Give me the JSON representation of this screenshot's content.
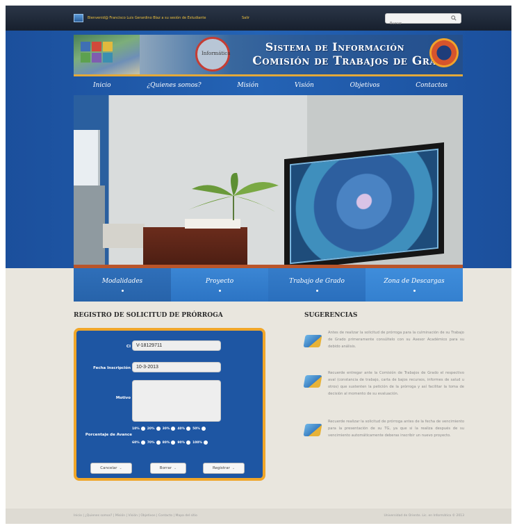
{
  "topbar": {
    "welcome": "Bienvenid@ Francisco Luis Gerardino Blaz a su sesión de Estudiante",
    "logout": "Salir",
    "search_placeholder": "Buscar"
  },
  "banner": {
    "title_line1": "Sistema de Información",
    "title_line2": "Comisión de Trabajos de Grado",
    "seal_text": "Informática"
  },
  "main_nav": [
    "Inicio",
    "¿Quienes somos?",
    "Misión",
    "Visión",
    "Objetivos",
    "Contactos"
  ],
  "sub_nav": [
    "Modalidades",
    "Proyecto",
    "Trabajo de Grado",
    "Zona de Descargas"
  ],
  "form": {
    "heading": "REGISTRO DE SOLICITUD DE PRÓRROGA",
    "ci_label": "CI",
    "ci_value": "V-18129711",
    "fecha_label": "Fecha Inscripción",
    "fecha_value": "10-3-2013",
    "motivo_label": "Motivo",
    "avance_label": "Porcentaje de Avance",
    "percent_row1": [
      "10%",
      "20%",
      "30%",
      "40%",
      "50%"
    ],
    "percent_row2": [
      "60%",
      "70%",
      "80%",
      "90%",
      "100%"
    ],
    "buttons": {
      "cancel": "Cancelar",
      "clear": "Borrar",
      "submit": "Registrar"
    }
  },
  "suggestions": {
    "heading": "SUGERENCIAS",
    "items": [
      "Antes de realizar la solicitud de prórroga para la culminación de su Trabajo de Grado primeramente consúltelo con su Asesor Académico para su debido análisis.",
      "Recuerde entregar ante la Comisión de Trabajos de Grado el respectivo aval (constancia de trabajo, carta de bajos recursos, informes de salud u otros) que sustenten la petición de la prórroga y así facilitar la toma de decisión al momento de su evaluación.",
      "Recuerde realizar la solicitud de prórroga antes de la fecha de vencimiento para la presentación de su TG, ya que si la realiza después de su vencimiento automáticamente deberas inscribir un nuevo proyecto."
    ]
  },
  "footer": {
    "links": "Inicio | ¿Quienes somos? | Misión | Visión | Objetivos | Contacto | Mapa del sitio",
    "copyright": "Universidad de Oriente. Lic. en Informática © 2013"
  }
}
